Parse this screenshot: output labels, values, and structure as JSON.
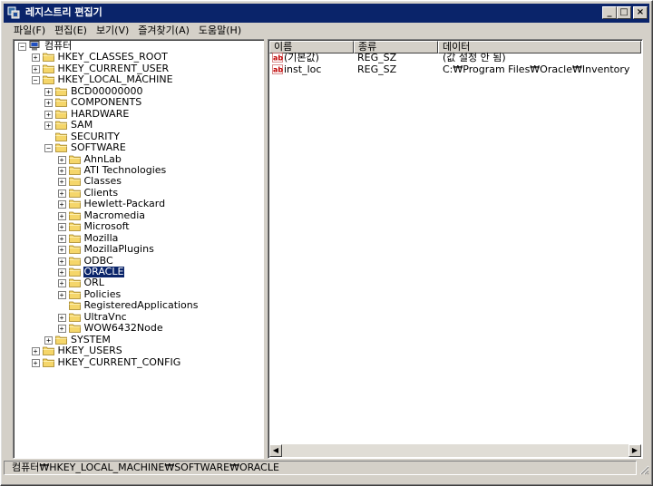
{
  "window": {
    "title": "레지스트리 편집기"
  },
  "title_buttons": {
    "minimize": "_",
    "maximize": "□",
    "close": "×"
  },
  "menu": [
    "파일(F)",
    "편집(E)",
    "보기(V)",
    "즐겨찾기(A)",
    "도움말(H)"
  ],
  "tree": [
    {
      "label": "컴퓨터",
      "depth": 0,
      "expander": "-",
      "icon": "computer-icon"
    },
    {
      "label": "HKEY_CLASSES_ROOT",
      "depth": 1,
      "expander": "+"
    },
    {
      "label": "HKEY_CURRENT_USER",
      "depth": 1,
      "expander": "+"
    },
    {
      "label": "HKEY_LOCAL_MACHINE",
      "depth": 1,
      "expander": "-"
    },
    {
      "label": "BCD00000000",
      "depth": 2,
      "expander": "+"
    },
    {
      "label": "COMPONENTS",
      "depth": 2,
      "expander": "+"
    },
    {
      "label": "HARDWARE",
      "depth": 2,
      "expander": "+"
    },
    {
      "label": "SAM",
      "depth": 2,
      "expander": "+"
    },
    {
      "label": "SECURITY",
      "depth": 2,
      "expander": ""
    },
    {
      "label": "SOFTWARE",
      "depth": 2,
      "expander": "-"
    },
    {
      "label": "AhnLab",
      "depth": 3,
      "expander": "+"
    },
    {
      "label": "ATI Technologies",
      "depth": 3,
      "expander": "+"
    },
    {
      "label": "Classes",
      "depth": 3,
      "expander": "+"
    },
    {
      "label": "Clients",
      "depth": 3,
      "expander": "+"
    },
    {
      "label": "Hewlett-Packard",
      "depth": 3,
      "expander": "+"
    },
    {
      "label": "Macromedia",
      "depth": 3,
      "expander": "+"
    },
    {
      "label": "Microsoft",
      "depth": 3,
      "expander": "+"
    },
    {
      "label": "Mozilla",
      "depth": 3,
      "expander": "+"
    },
    {
      "label": "MozillaPlugins",
      "depth": 3,
      "expander": "+"
    },
    {
      "label": "ODBC",
      "depth": 3,
      "expander": "+"
    },
    {
      "label": "ORACLE",
      "depth": 3,
      "expander": "+",
      "selected": true
    },
    {
      "label": "ORL",
      "depth": 3,
      "expander": "+"
    },
    {
      "label": "Policies",
      "depth": 3,
      "expander": "+"
    },
    {
      "label": "RegisteredApplications",
      "depth": 3,
      "expander": ""
    },
    {
      "label": "UltraVnc",
      "depth": 3,
      "expander": "+"
    },
    {
      "label": "WOW6432Node",
      "depth": 3,
      "expander": "+"
    },
    {
      "label": "SYSTEM",
      "depth": 2,
      "expander": "+"
    },
    {
      "label": "HKEY_USERS",
      "depth": 1,
      "expander": "+"
    },
    {
      "label": "HKEY_CURRENT_CONFIG",
      "depth": 1,
      "expander": "+"
    }
  ],
  "list": {
    "columns": [
      "이름",
      "종류",
      "데이터"
    ],
    "rows": [
      {
        "name": "(기본값)",
        "type": "REG_SZ",
        "data": "(값 설정 안 됨)",
        "icon": "string-value-icon"
      },
      {
        "name": "inst_loc",
        "type": "REG_SZ",
        "data": "C:₩Program Files₩Oracle₩Inventory",
        "icon": "string-value-icon"
      }
    ]
  },
  "statusbar": {
    "path": "컴퓨터₩HKEY_LOCAL_MACHINE₩SOFTWARE₩ORACLE"
  },
  "colors": {
    "titlebar": "#0a246a",
    "face": "#d4d0c8",
    "selection": "#0a246a",
    "folder": "#f5d66a"
  }
}
